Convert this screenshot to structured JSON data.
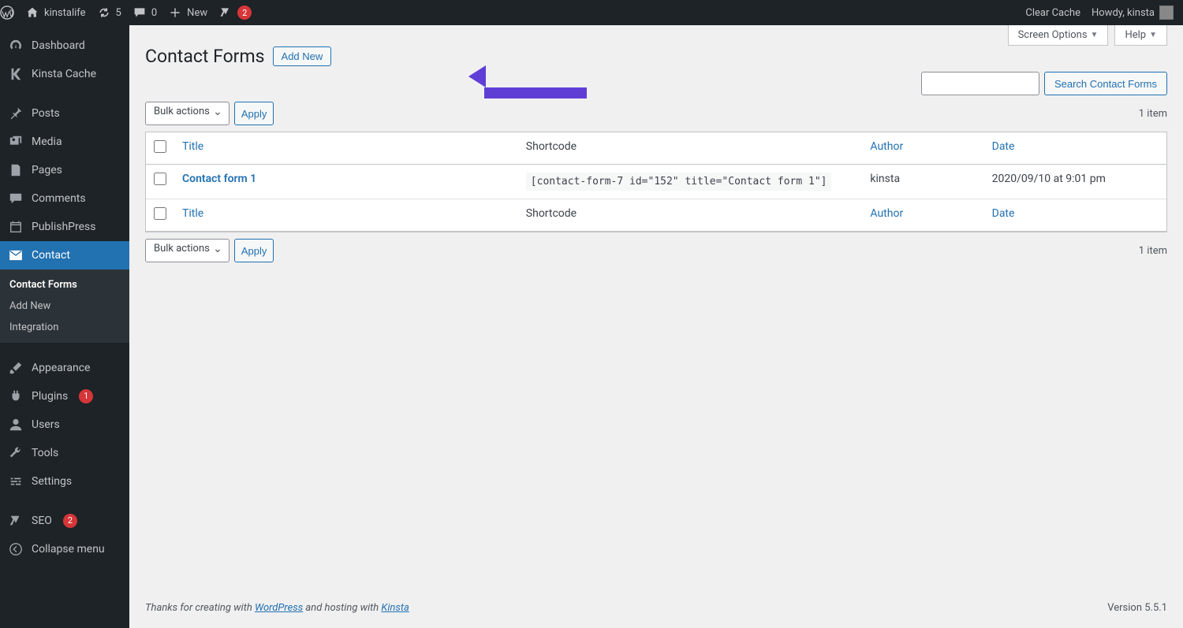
{
  "adminbar": {
    "site_name": "kinstalife",
    "updates_count": "5",
    "comments_count": "0",
    "new_label": "New",
    "yoast_badge": "2",
    "clear_cache": "Clear Cache",
    "howdy": "Howdy, kinsta"
  },
  "sidebar": {
    "dashboard": "Dashboard",
    "kinsta_cache": "Kinsta Cache",
    "posts": "Posts",
    "media": "Media",
    "pages": "Pages",
    "comments": "Comments",
    "publishpress": "PublishPress",
    "contact": "Contact",
    "contact_sub": {
      "contact_forms": "Contact Forms",
      "add_new": "Add New",
      "integration": "Integration"
    },
    "appearance": "Appearance",
    "plugins": "Plugins",
    "plugins_count": "1",
    "users": "Users",
    "tools": "Tools",
    "settings": "Settings",
    "seo": "SEO",
    "seo_count": "2",
    "collapse": "Collapse menu"
  },
  "screen": {
    "screen_options": "Screen Options",
    "help": "Help"
  },
  "page": {
    "title": "Contact Forms",
    "add_new": "Add New"
  },
  "search": {
    "button": "Search Contact Forms"
  },
  "bulk": {
    "label": "Bulk actions",
    "apply": "Apply"
  },
  "items_count": "1 item",
  "table": {
    "headers": {
      "title": "Title",
      "shortcode": "Shortcode",
      "author": "Author",
      "date": "Date"
    },
    "rows": [
      {
        "title": "Contact form 1",
        "shortcode": "[contact-form-7 id=\"152\" title=\"Contact form 1\"]",
        "author": "kinsta",
        "date": "2020/09/10 at 9:01 pm"
      }
    ]
  },
  "footer": {
    "prefix": "Thanks for creating with ",
    "wp": "WordPress",
    "mid": " and hosting with ",
    "kinsta": "Kinsta",
    "version": "Version 5.5.1"
  }
}
